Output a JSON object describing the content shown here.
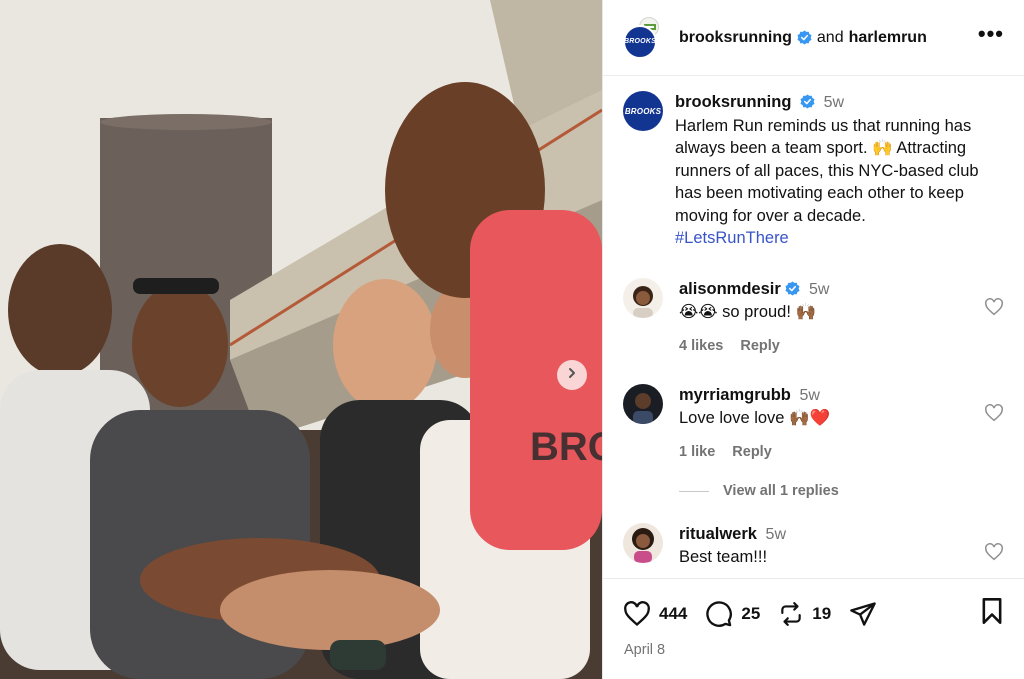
{
  "post": {
    "photo_alt": "",
    "next_icon": "chevron-right-icon"
  },
  "header": {
    "account": "brooksruning_placeholder",
    "account_name": "brooksrunning",
    "joiner": "and",
    "collaborator": "harlemrun",
    "brand_logo_text": "BROOKS",
    "more_icon": "more-horizontal-icon",
    "more_label": "•••"
  },
  "caption": {
    "username": "brooksrunning",
    "age": "5w",
    "text": "Harlem Run reminds us that running has always been a team sport. 🙌 Attracting runners of all paces, this NYC-based club has been motivating each other to keep moving for over a decade.",
    "hashtag": "#LetsRunThere"
  },
  "comments": [
    {
      "username": "alisonmdesir",
      "verified": true,
      "age": "5w",
      "text": "😭😭 so proud! 🙌🏾",
      "likes": "4 likes",
      "reply": "Reply"
    },
    {
      "username": "myrriamgrubb",
      "verified": false,
      "age": "5w",
      "text": "Love love love 🙌🏾❤️",
      "likes": "1 like",
      "reply": "Reply"
    },
    {
      "username": "ritualwerk",
      "verified": false,
      "age": "5w",
      "text": "Best team!!!"
    }
  ],
  "view_replies": "View all 1 replies",
  "footer": {
    "likes_count": "444",
    "comments_count": "25",
    "reposts_count": "19",
    "date": "April 8"
  },
  "colors": {
    "verified": "#3897f0",
    "brand_blue": "#133592",
    "hashtag": "#3854c9",
    "muted": "#737373"
  }
}
